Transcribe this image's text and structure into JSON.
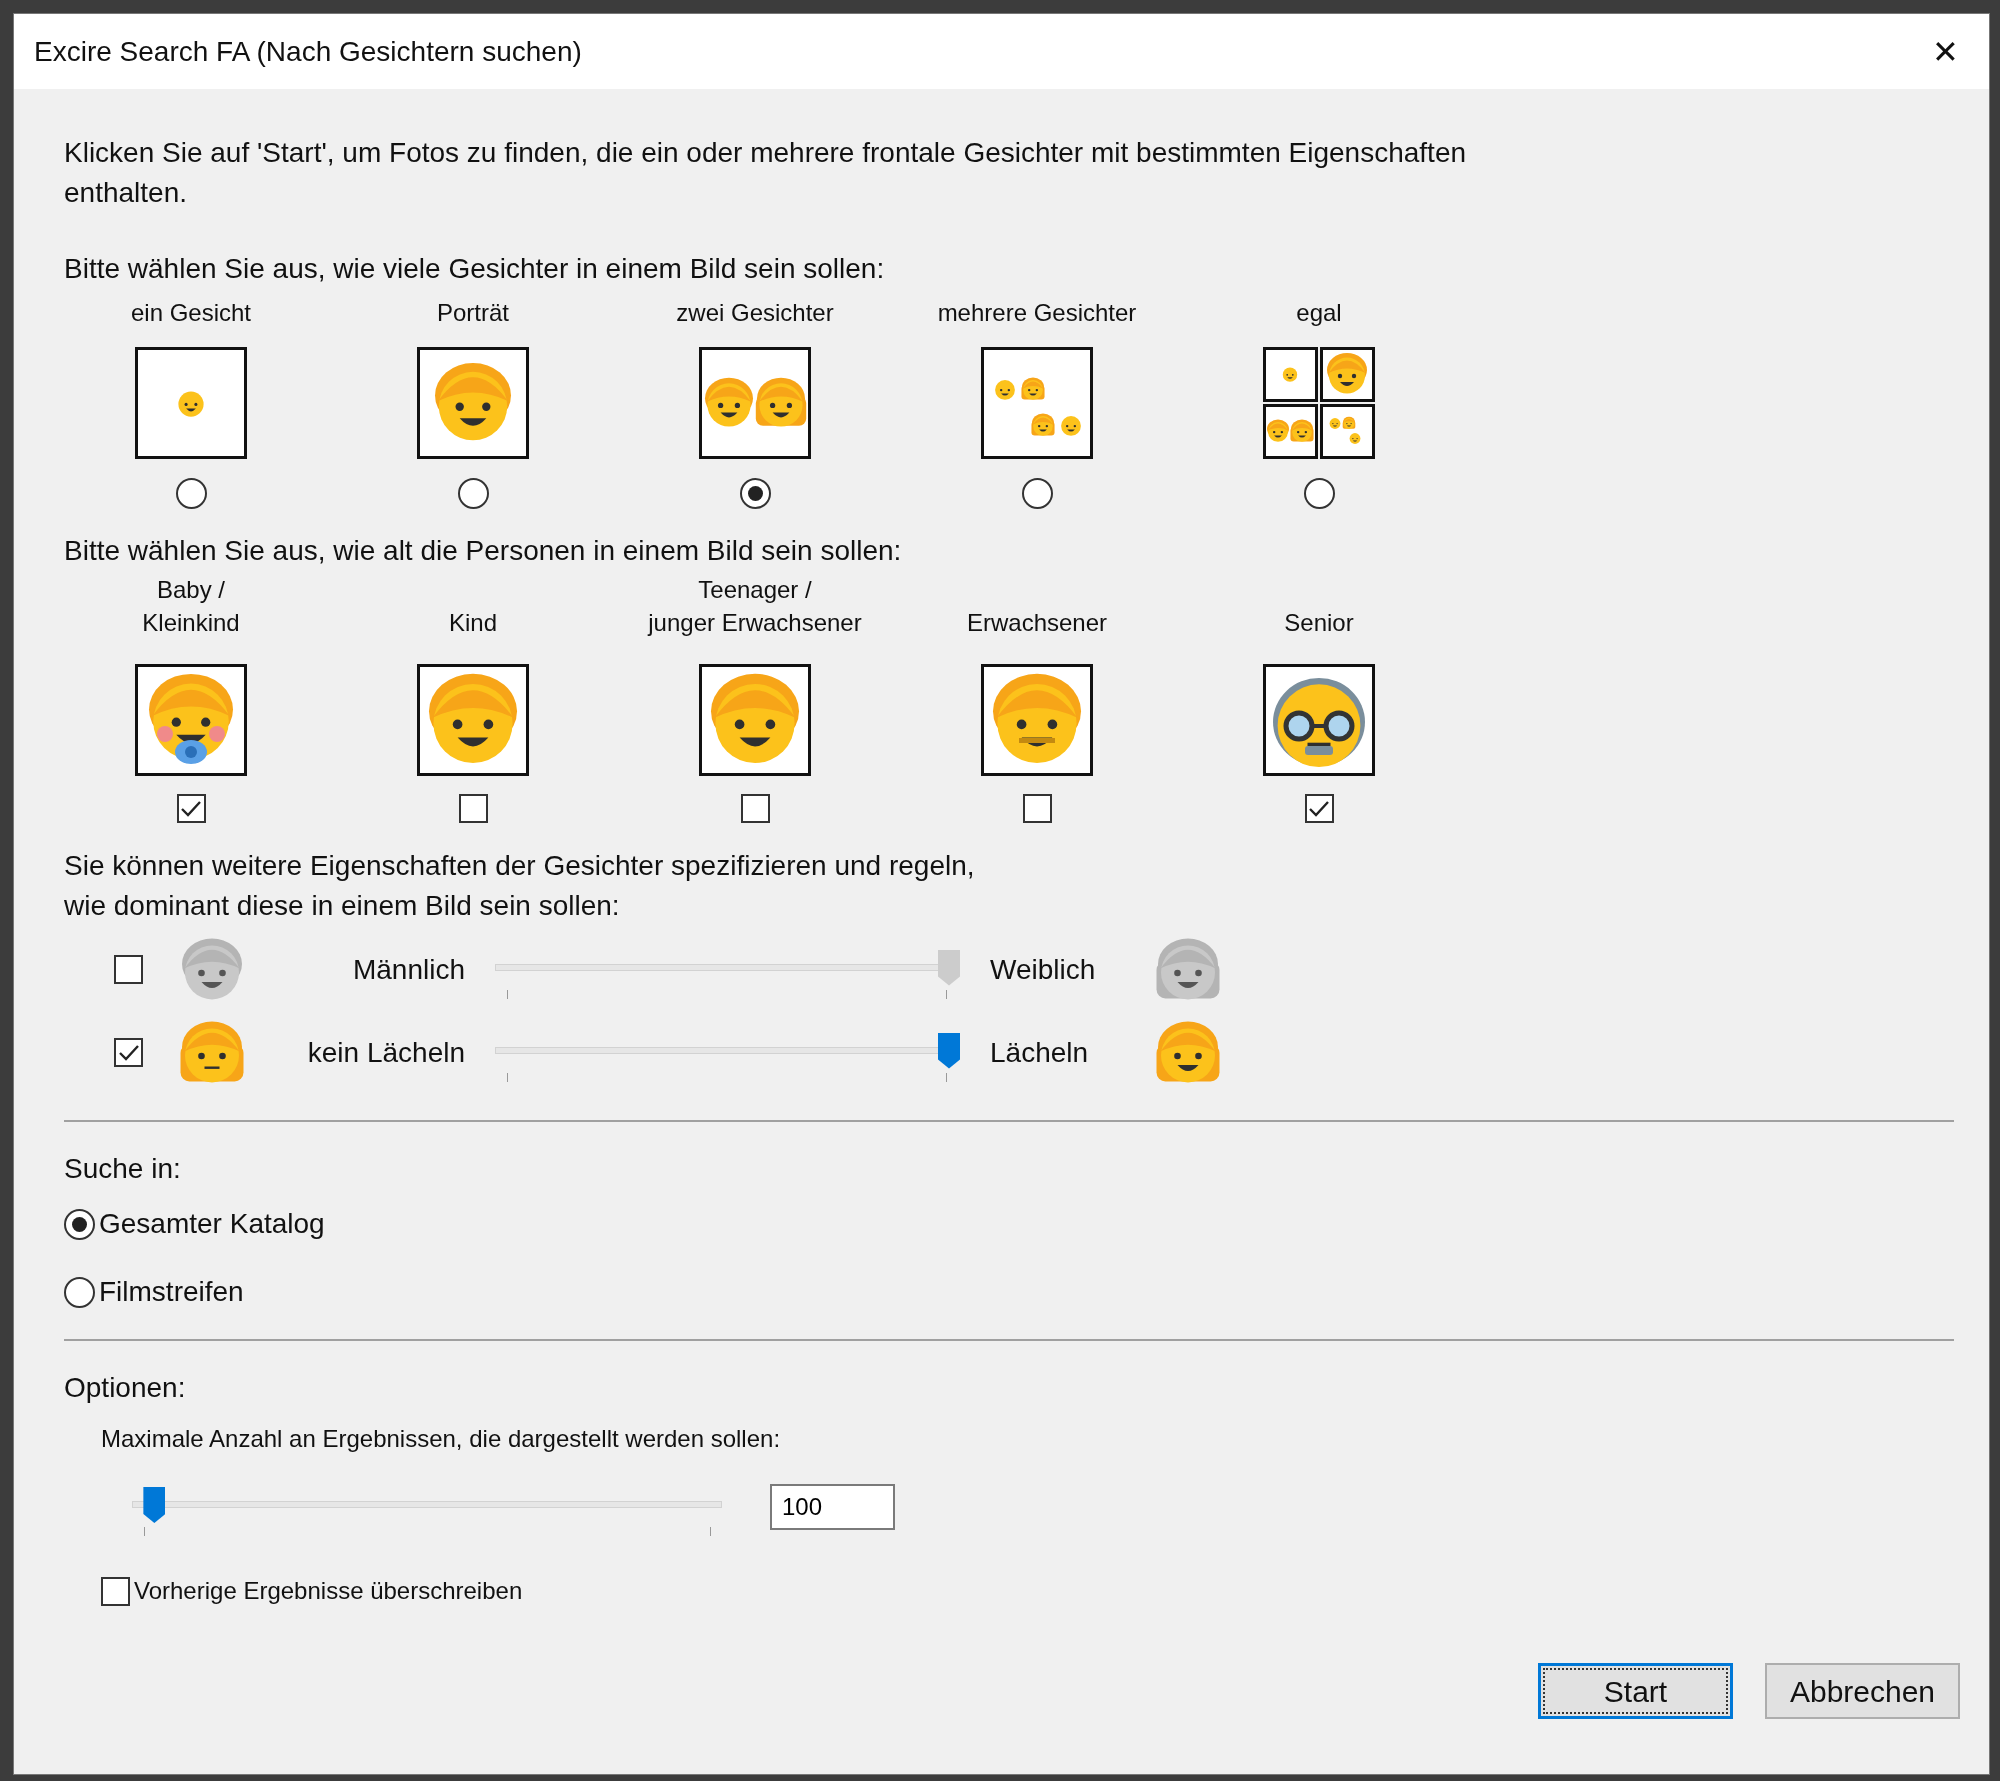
{
  "window": {
    "title": "Excire Search FA (Nach Gesichtern suchen)",
    "close": "✕"
  },
  "intro": "Klicken Sie auf 'Start', um Fotos zu finden, die ein oder mehrere frontale Gesichter mit bestimmten Eigenschaften enthalten.",
  "face_count": {
    "prompt": "Bitte wählen Sie aus, wie viele Gesichter in einem Bild sein sollen:",
    "options": [
      {
        "label": "ein Gesicht",
        "selected": false
      },
      {
        "label": "Porträt",
        "selected": false
      },
      {
        "label": "zwei Gesichter",
        "selected": true
      },
      {
        "label": "mehrere Gesichter",
        "selected": false
      },
      {
        "label": "egal",
        "selected": false
      }
    ]
  },
  "age": {
    "prompt": "Bitte wählen Sie aus, wie alt die Personen in einem Bild sein sollen:",
    "options": [
      {
        "label": "Baby /\nKleinkind",
        "checked": true
      },
      {
        "label": "Kind",
        "checked": false
      },
      {
        "label": "Teenager /\njunger Erwachsener",
        "checked": false
      },
      {
        "label": "Erwachsener",
        "checked": false
      },
      {
        "label": "Senior",
        "checked": true
      }
    ]
  },
  "properties": {
    "prompt": "Sie können weitere Eigenschaften der Gesichter spezifizieren und regeln,\nwie dominant diese in einem Bild sein sollen:",
    "rows": [
      {
        "checked": false,
        "left_label": "Männlich",
        "right_label": "Weiblich",
        "level": 1
      },
      {
        "checked": true,
        "left_label": "kein Lächeln",
        "right_label": "Lächeln",
        "level": 1
      }
    ]
  },
  "search_in": {
    "label": "Suche in:",
    "options": [
      {
        "label": "Gesamter Katalog",
        "selected": true
      },
      {
        "label": "Filmstreifen",
        "selected": false
      }
    ]
  },
  "options": {
    "label": "Optionen:",
    "max_results_label": "Maximale Anzahl an Ergebnissen, die dargestellt werden sollen:",
    "level": 0.02,
    "value": "100",
    "overwrite": {
      "label": "Vorherige Ergebnisse überschreiben",
      "checked": false
    }
  },
  "buttons": [
    {
      "label": "Start",
      "default": true
    },
    {
      "label": "Abbrechen",
      "default": false
    }
  ]
}
